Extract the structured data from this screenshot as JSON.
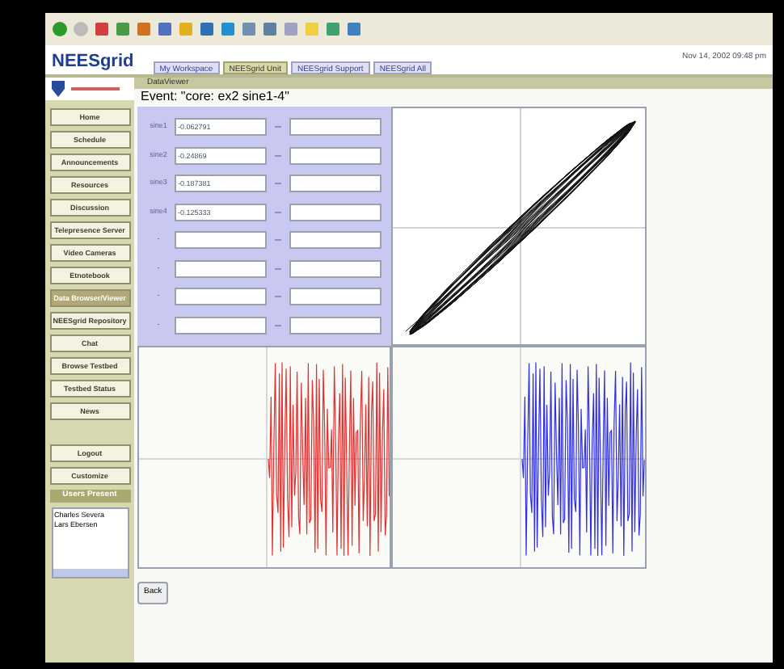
{
  "header": {
    "logo": "NEESgrid",
    "date": "Nov 14, 2002 09:48 pm"
  },
  "tabs": [
    {
      "label": "My Workspace",
      "selected": false
    },
    {
      "label": "NEESgrid Unit",
      "selected": true
    },
    {
      "label": "NEESgrid Support",
      "selected": false
    },
    {
      "label": "NEESgrid All",
      "selected": false
    }
  ],
  "tool_title": "DataViewer",
  "event": "Event: \"core: ex2 sine1-4\"",
  "sidebar": {
    "items": [
      {
        "label": "Home",
        "selected": false
      },
      {
        "label": "Schedule",
        "selected": false
      },
      {
        "label": "Announcements",
        "selected": false
      },
      {
        "label": "Resources",
        "selected": false
      },
      {
        "label": "Discussion",
        "selected": false
      },
      {
        "label": "Telepresence Server",
        "selected": false
      },
      {
        "label": "Video Cameras",
        "selected": false
      },
      {
        "label": "Etnotebook",
        "selected": false
      },
      {
        "label": "Data Browser/Viewer",
        "selected": true
      },
      {
        "label": "NEESgrid Repository",
        "selected": false
      },
      {
        "label": "Chat",
        "selected": false
      },
      {
        "label": "Browse Testbed",
        "selected": false
      },
      {
        "label": "Testbed Status",
        "selected": false
      },
      {
        "label": "News",
        "selected": false
      }
    ],
    "account_items": [
      {
        "label": "Logout"
      },
      {
        "label": "Customize"
      }
    ],
    "users_present": {
      "title": "Users Present",
      "users": [
        "Charles Severa",
        "Lars Ebersen"
      ]
    }
  },
  "channels": [
    {
      "name": "sine1",
      "value": "-0.062791"
    },
    {
      "name": "sine2",
      "value": "-0.24869"
    },
    {
      "name": "sine3",
      "value": "-0.187381"
    },
    {
      "name": "sine4",
      "value": "-0.125333"
    },
    {
      "name": "-"
    },
    {
      "name": "-"
    },
    {
      "name": "-"
    },
    {
      "name": "-"
    }
  ],
  "back_button": "Back"
}
